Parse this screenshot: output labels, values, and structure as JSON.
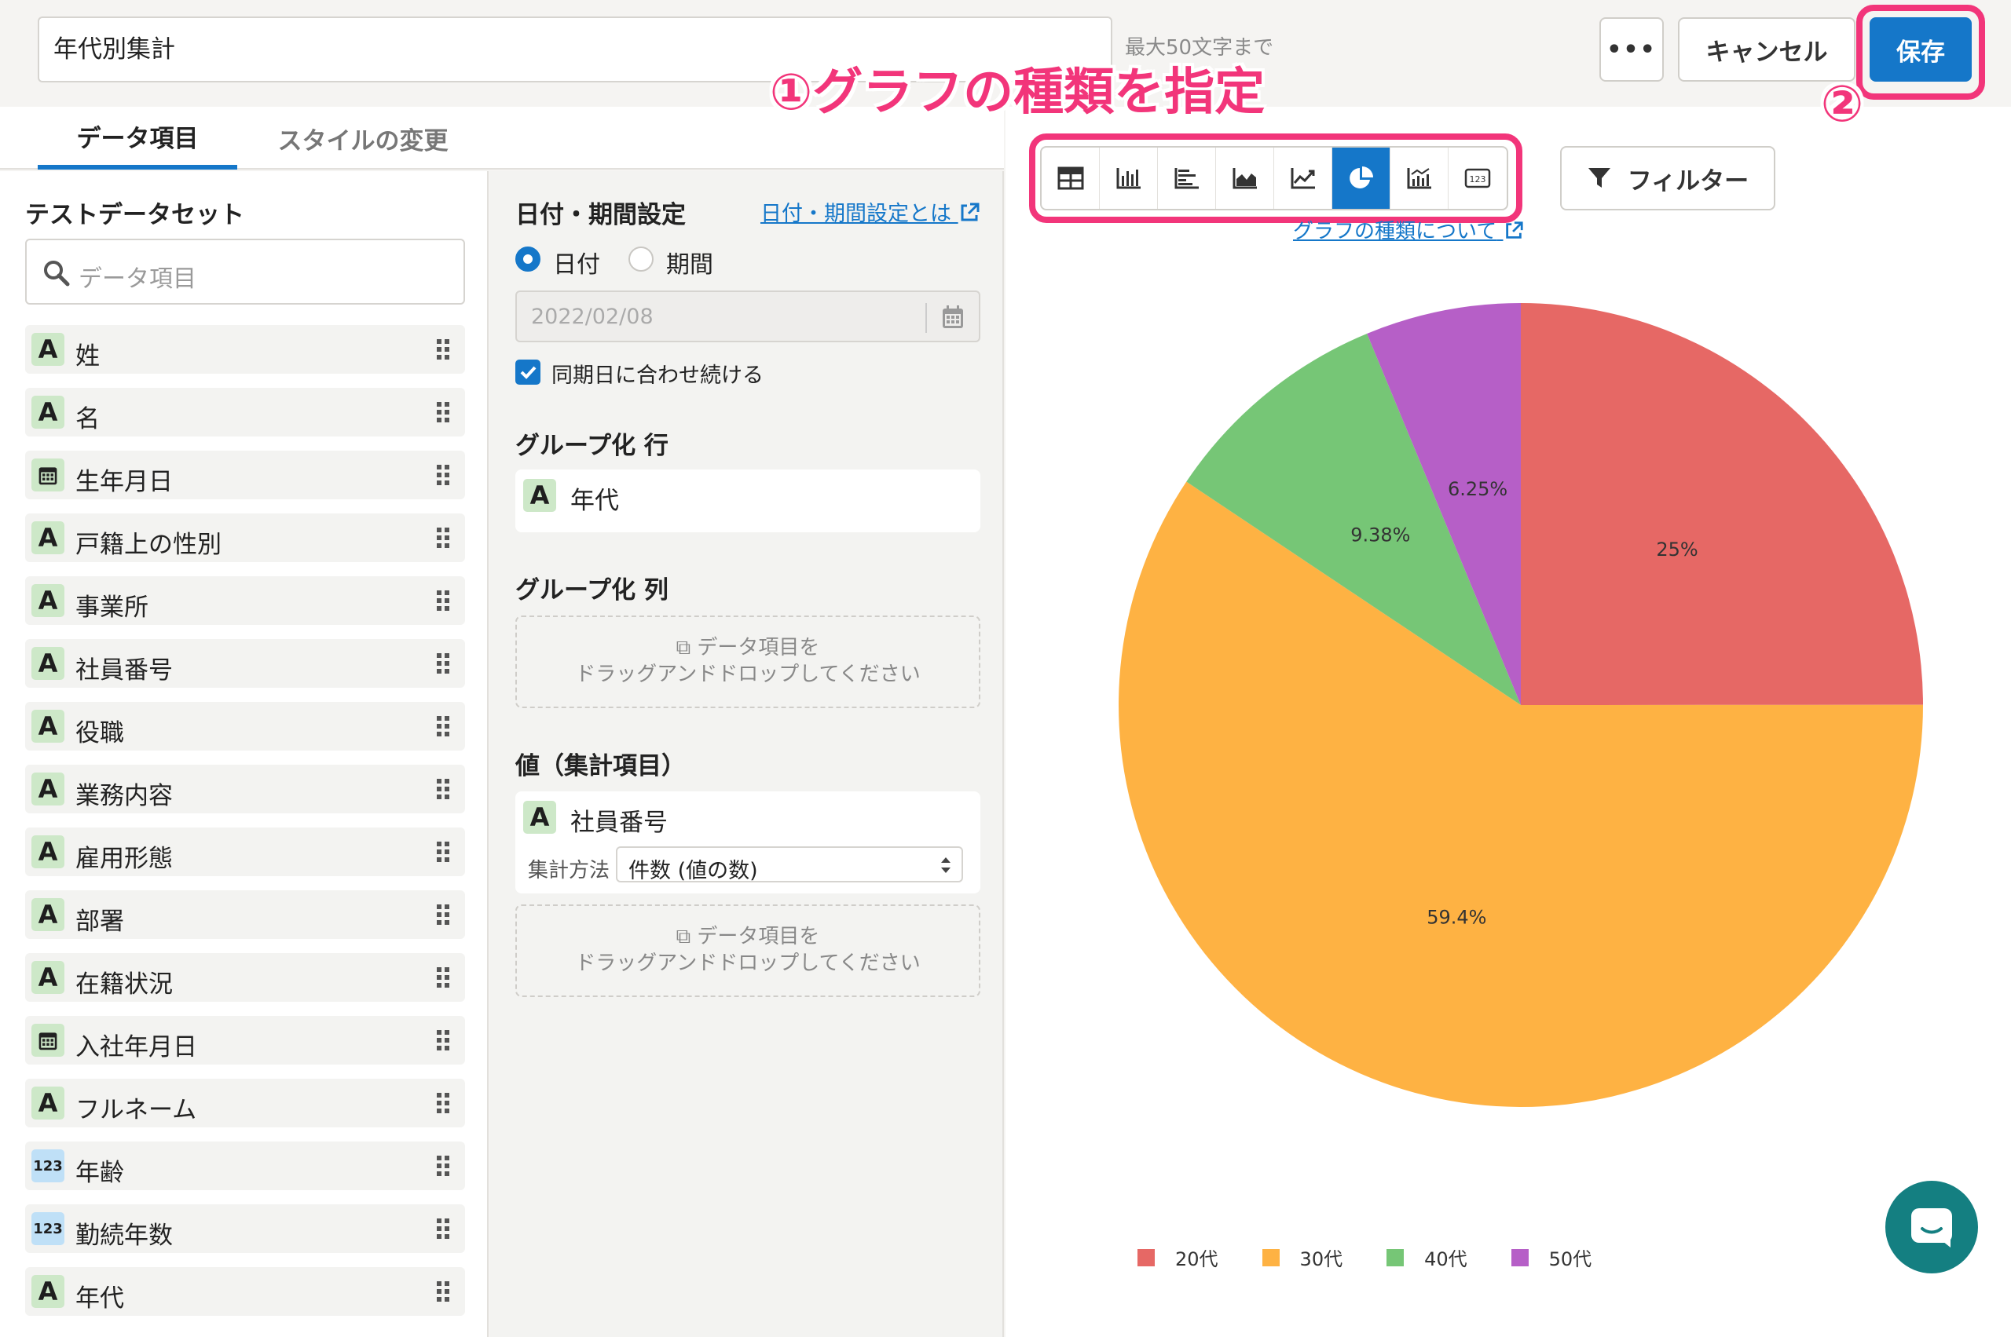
{
  "header": {
    "title_value": "年代別集計",
    "title_hint": "最大50文字まで",
    "more_label": "•••",
    "cancel_label": "キャンセル",
    "save_label": "保存"
  },
  "annotations": {
    "step1": "①グラフの種類を指定",
    "step2": "②"
  },
  "tabs": [
    "データ項目",
    "スタイルの変更"
  ],
  "dataset": {
    "title": "テストデータセット",
    "search_placeholder": "データ項目",
    "fields": [
      {
        "type": "text",
        "icon_text": "A",
        "label": "姓"
      },
      {
        "type": "text",
        "icon_text": "A",
        "label": "名"
      },
      {
        "type": "date",
        "icon_text": "",
        "label": "生年月日"
      },
      {
        "type": "text",
        "icon_text": "A",
        "label": "戸籍上の性別"
      },
      {
        "type": "text",
        "icon_text": "A",
        "label": "事業所"
      },
      {
        "type": "text",
        "icon_text": "A",
        "label": "社員番号"
      },
      {
        "type": "text",
        "icon_text": "A",
        "label": "役職"
      },
      {
        "type": "text",
        "icon_text": "A",
        "label": "業務内容"
      },
      {
        "type": "text",
        "icon_text": "A",
        "label": "雇用形態"
      },
      {
        "type": "text",
        "icon_text": "A",
        "label": "部署"
      },
      {
        "type": "text",
        "icon_text": "A",
        "label": "在籍状況"
      },
      {
        "type": "date",
        "icon_text": "",
        "label": "入社年月日"
      },
      {
        "type": "text",
        "icon_text": "A",
        "label": "フルネーム"
      },
      {
        "type": "number",
        "icon_text": "123",
        "label": "年齢"
      },
      {
        "type": "number",
        "icon_text": "123",
        "label": "勤続年数"
      },
      {
        "type": "text",
        "icon_text": "A",
        "label": "年代"
      }
    ]
  },
  "settings": {
    "date_title": "日付・期間設定",
    "date_help": "日付・期間設定とは",
    "radio_date": "日付",
    "radio_period": "期間",
    "date_value": "2022/02/08",
    "same_day_label": "同期日に合わせ続ける",
    "group_row_title": "グループ化 行",
    "group_row_icon": "A",
    "group_row_field": "年代",
    "group_col_title": "グループ化 列",
    "drop_line1": "データ項目を",
    "drop_line2": "ドラッグアンドドロップしてください",
    "value_title": "値（集計項目）",
    "value_icon": "A",
    "value_field": "社員番号",
    "agg_label": "集計方法",
    "agg_value": "件数 (値の数)"
  },
  "chart_toolbar": {
    "types": [
      "table-icon",
      "bar-chart-icon",
      "horizontal-bar-icon",
      "area-chart-icon",
      "line-chart-icon",
      "pie-chart-icon",
      "combo-chart-icon",
      "number-icon"
    ],
    "active": "pie-chart-icon",
    "filter_label": "フィルター",
    "help_link": "グラフの種類について"
  },
  "colors": {
    "accent": "#1577c9",
    "annotation": "#f2357a"
  },
  "chart_data": {
    "type": "pie",
    "categories": [
      "20代",
      "30代",
      "40代",
      "50代"
    ],
    "values": [
      25,
      59.4,
      9.38,
      6.25
    ],
    "data_labels": [
      "25%",
      "59.4%",
      "9.38%",
      "6.25%"
    ],
    "colors": [
      "#e66865",
      "#feb243",
      "#76c676",
      "#b65fc7"
    ],
    "legend_position": "bottom"
  }
}
